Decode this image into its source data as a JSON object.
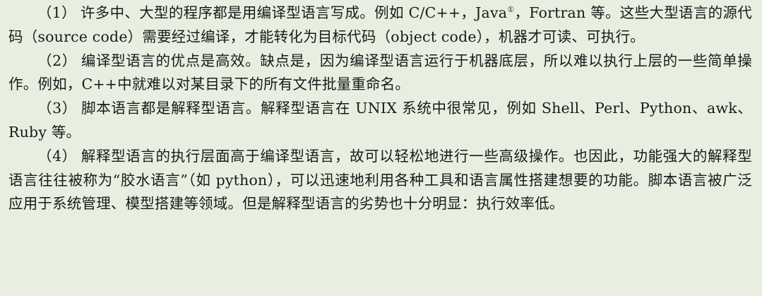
{
  "paragraphs": [
    {
      "number": "（1）",
      "text_a": "许多中、大型的程序都是用编译型语言写成。例如 C/C++，Java",
      "footnote_mark": "①",
      "text_b": "，Fortran 等。这些大型语言的源代码（source code）需要经过编译，才能转化为目标代码（object code），机器才可读、可执行。"
    },
    {
      "number": "（2）",
      "text": "编译型语言的优点是高效。缺点是，因为编译型语言运行于机器底层，所以难以执行上层的一些简单操作。例如，C++中就难以对某目录下的所有文件批量重命名。"
    },
    {
      "number": "（3）",
      "text": "脚本语言都是解释型语言。解释型语言在 UNIX 系统中很常见，例如 Shell、Perl、Python、awk、Ruby 等。"
    },
    {
      "number": "（4）",
      "text": "解释型语言的执行层面高于编译型语言，故可以轻松地进行一些高级操作。也因此，功能强大的解释型语言往往被称为“胶水语言”（如 python），可以迅速地利用各种工具和语言属性搭建想要的功能。脚本语言被广泛应用于系统管理、模型搭建等领域。但是解释型语言的劣势也十分明显：执行效率低。"
    }
  ]
}
